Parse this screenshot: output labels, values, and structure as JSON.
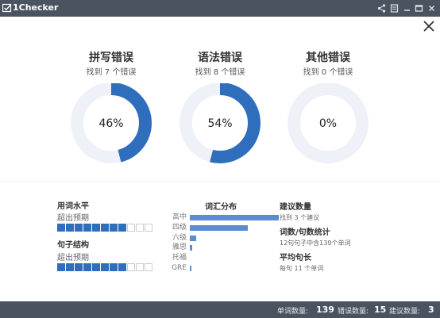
{
  "app": {
    "title": "1Checker"
  },
  "titlebar_icons": [
    "share-icon",
    "menu-icon",
    "minimize-icon",
    "maximize-icon",
    "close-icon"
  ],
  "summary": [
    {
      "title": "拼写错误",
      "found": "找到 7 个错误",
      "percent_text": "46%",
      "percent": 46
    },
    {
      "title": "语法错误",
      "found": "找到 8 个错误",
      "percent_text": "54%",
      "percent": 54
    },
    {
      "title": "其他错误",
      "found": "找到 0 个错误",
      "percent_text": "0%",
      "percent": 0
    }
  ],
  "colors": {
    "accent": "#2f6ebd",
    "ring_track": "#eef2f8",
    "titlebar": "#4a5460",
    "vocab_bar": "#5b8bd0"
  },
  "word_level": {
    "title": "用词水平",
    "status": "超出预期",
    "filled": 8,
    "total": 11
  },
  "sentence_structure": {
    "title": "句子结构",
    "status": "超出预期",
    "filled": 8,
    "total": 11
  },
  "vocabulary": {
    "title": "词汇分布",
    "items": [
      {
        "label": "高中",
        "value": 100
      },
      {
        "label": "四级",
        "value": 65
      },
      {
        "label": "六级",
        "value": 7
      },
      {
        "label": "雅思",
        "value": 3
      },
      {
        "label": "托福",
        "value": 0
      },
      {
        "label": "GRE",
        "value": 2
      }
    ]
  },
  "suggestions": {
    "count_title": "建议数量",
    "count_text": "找到 3 个建议",
    "stats_title": "词数/句数统计",
    "stats_text": "12句句子中含139个单词",
    "avg_title": "平均句长",
    "avg_text": "每句 11 个单词"
  },
  "status": {
    "words_label": "单词数量:",
    "words_value": "139",
    "errors_label": "错误数量:",
    "errors_value": "15",
    "suggest_label": "建议数量:",
    "suggest_value": "3"
  }
}
